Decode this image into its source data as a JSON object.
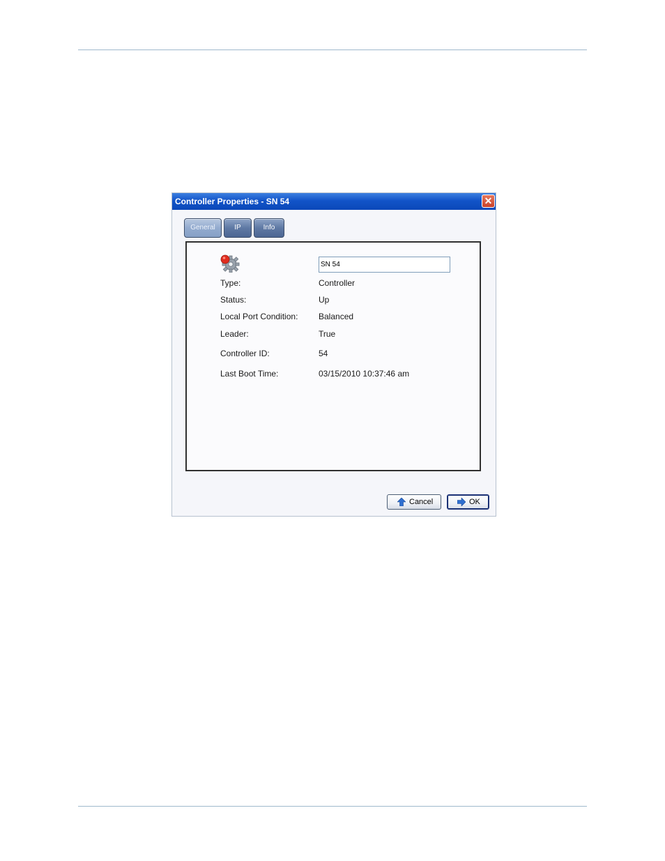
{
  "dialog": {
    "title": "Controller Properties - SN 54",
    "close_glyph": "✕",
    "tabs": [
      {
        "label": "General",
        "active": true
      },
      {
        "label": "IP",
        "active": false
      },
      {
        "label": "Info",
        "active": false
      }
    ],
    "name_field": {
      "value": "SN 54"
    },
    "properties": [
      {
        "label": "Type:",
        "value": "Controller"
      },
      {
        "label": "Status:",
        "value": "Up"
      },
      {
        "label": "Local Port Condition:",
        "value": "Balanced"
      },
      {
        "label": "Leader:",
        "value": "True"
      },
      {
        "label": "Controller ID:",
        "value": "54"
      },
      {
        "label": "Last Boot Time:",
        "value": "03/15/2010 10:37:46 am"
      }
    ],
    "buttons": {
      "cancel": "Cancel",
      "ok": "OK"
    },
    "icons": {
      "controller": "gear-icon",
      "cancel": "arrow-up-icon",
      "ok": "arrow-right-icon",
      "close": "close-icon"
    },
    "colors": {
      "titlebar": "#0b48b9",
      "close": "#c9412a",
      "tab": "#5f79a4",
      "status_dot": "#e02c1e"
    }
  }
}
